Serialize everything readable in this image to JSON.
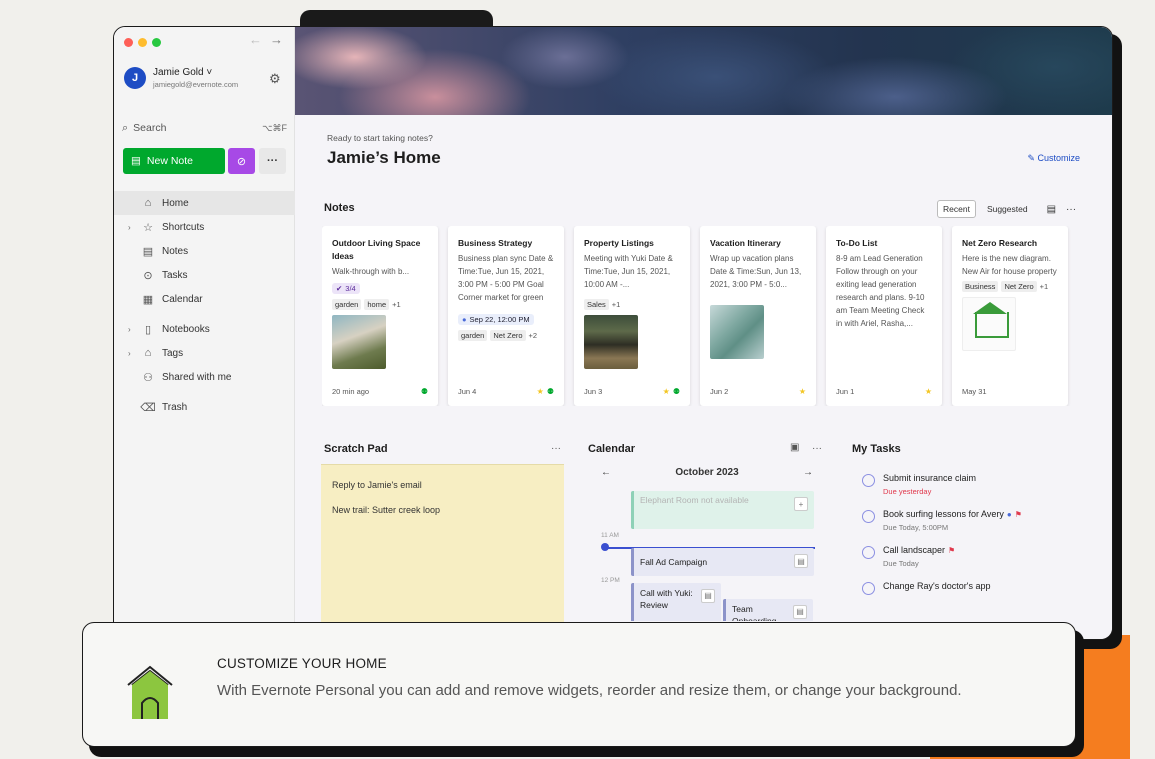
{
  "colors": {
    "new_note_green": "#00a82d",
    "task_purple": "#a749e6",
    "link_blue": "#1d4cc4",
    "scratch_yellow": "#f7eec3",
    "accent_orange": "#f57d1f"
  },
  "sidebar": {
    "user": {
      "initial": "J",
      "name": "Jamie Gold ˅",
      "email": "jamiegold@evernote.com"
    },
    "search": {
      "label": "Search",
      "shortcut": "⌥⌘F"
    },
    "new_note": "New Note",
    "nav": [
      {
        "label": "Home",
        "icon": "home-icon"
      },
      {
        "label": "Shortcuts",
        "icon": "star-icon"
      },
      {
        "label": "Notes",
        "icon": "note-icon"
      },
      {
        "label": "Tasks",
        "icon": "check-circle-icon"
      },
      {
        "label": "Calendar",
        "icon": "calendar-icon"
      },
      {
        "label": "Notebooks",
        "icon": "notebook-icon"
      },
      {
        "label": "Tags",
        "icon": "tag-icon"
      },
      {
        "label": "Shared with me",
        "icon": "people-icon"
      },
      {
        "label": "Trash",
        "icon": "trash-icon"
      }
    ]
  },
  "home": {
    "subtitle": "Ready to start taking notes?",
    "title": "Jamie’s Home",
    "customize": "Customize"
  },
  "notes": {
    "title": "Notes",
    "tabs": {
      "recent": "Recent",
      "suggested": "Suggested"
    },
    "cards": [
      {
        "title": "Outdoor Living Space Ideas",
        "body": "Walk-through with b...",
        "pill": "3/4",
        "chips": [
          "garden",
          "home"
        ],
        "more": "+1",
        "date": "20 min ago"
      },
      {
        "title": "Business Strategy",
        "body": "Business plan sync Date & Time:Tue, Jun 15, 2021, 3:00 PM - 5:00 PM Goal Corner market for green",
        "pill": "Sep 22, 12:00 PM",
        "chips": [
          "garden",
          "Net Zero"
        ],
        "more": "+2",
        "date": "Jun 4"
      },
      {
        "title": "Property Listings",
        "body": "Meeting with Yuki Date & Time:Tue, Jun 15, 2021, 10:00 AM -...",
        "chips": [
          "Sales"
        ],
        "more": "+1",
        "date": "Jun 3"
      },
      {
        "title": "Vacation Itinerary",
        "body": "Wrap up vacation plans Date & Time:Sun, Jun 13, 2021, 3:00 PM - 5:0...",
        "date": "Jun 2"
      },
      {
        "title": "To-Do List",
        "body": "8-9 am Lead Generation Follow through on your exiting lead generation research and plans. 9-10 am Team Meeting Check in with Ariel, Rasha,...",
        "date": "Jun 1"
      },
      {
        "title": "Net Zero Research",
        "body": "Here is the new diagram. New Air for house property",
        "chips": [
          "Business",
          "Net Zero"
        ],
        "more": "+1",
        "date": "May 31"
      }
    ]
  },
  "scratch": {
    "title": "Scratch Pad",
    "lines": [
      "Reply to Jamie's email",
      "New trail: Sutter creek loop"
    ]
  },
  "calendar": {
    "title": "Calendar",
    "month": "October 2023",
    "times": [
      "11 AM",
      "12 PM"
    ],
    "events": [
      "Elephant Room not available",
      "Fall Ad Campaign",
      "Call with Yuki: Review",
      "Team Onboarding"
    ]
  },
  "tasks": {
    "title": "My Tasks",
    "items": [
      {
        "title": "Submit insurance claim",
        "due": "Due yesterday"
      },
      {
        "title": "Book surfing lessons for Avery",
        "due": "Due Today, 5:00PM"
      },
      {
        "title": "Call landscaper",
        "due": "Due Today"
      },
      {
        "title": "Change Ray's doctor's app",
        "due": ""
      }
    ]
  },
  "tip": {
    "title": "CUSTOMIZE YOUR HOME",
    "text": "With Evernote Personal you can add and remove widgets, reorder and resize them, or change your background."
  }
}
